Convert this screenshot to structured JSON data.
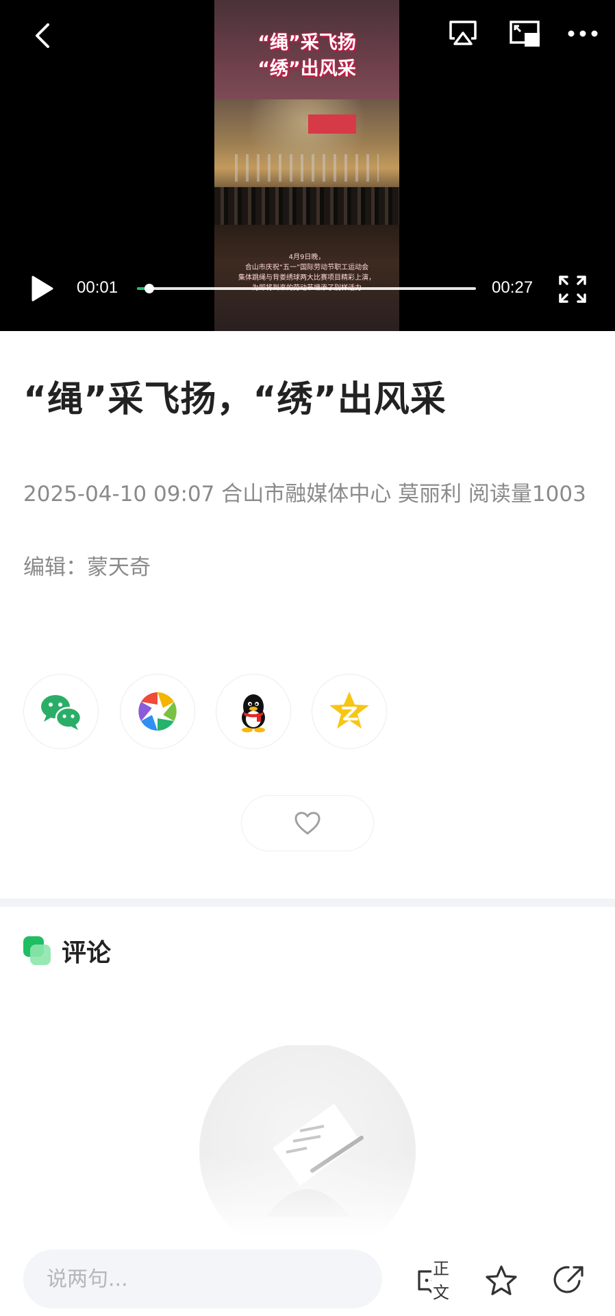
{
  "video": {
    "frame_title_line1": "“绳”采飞扬",
    "frame_title_line2": "“绣”出风采",
    "frame_caption": [
      "4月9日晚，",
      "合山市庆祝“五一”国际劳动节职工运动会",
      "集体跳绳与背娄绣球两大比赛项目精彩上演，",
      "为即将到来的劳动节增添了别样活力"
    ],
    "current_time": "00:01",
    "total_time": "00:27",
    "progress": 0.037,
    "progress_color": "#22c06a"
  },
  "article": {
    "headline": "“绳”采飞扬，“绣”出风采",
    "meta": "2025-04-10 09:07 合山市融媒体中心 莫丽利 阅读量1003",
    "editor": "编辑：蒙天奇"
  },
  "share": {
    "targets": [
      "wechat-icon",
      "moments-icon",
      "qq-icon",
      "qzone-icon"
    ]
  },
  "comments": {
    "title": "评论",
    "accent": "#1fbe63"
  },
  "bottom_bar": {
    "input_placeholder": "说两句...",
    "text_button_label": "正文"
  }
}
